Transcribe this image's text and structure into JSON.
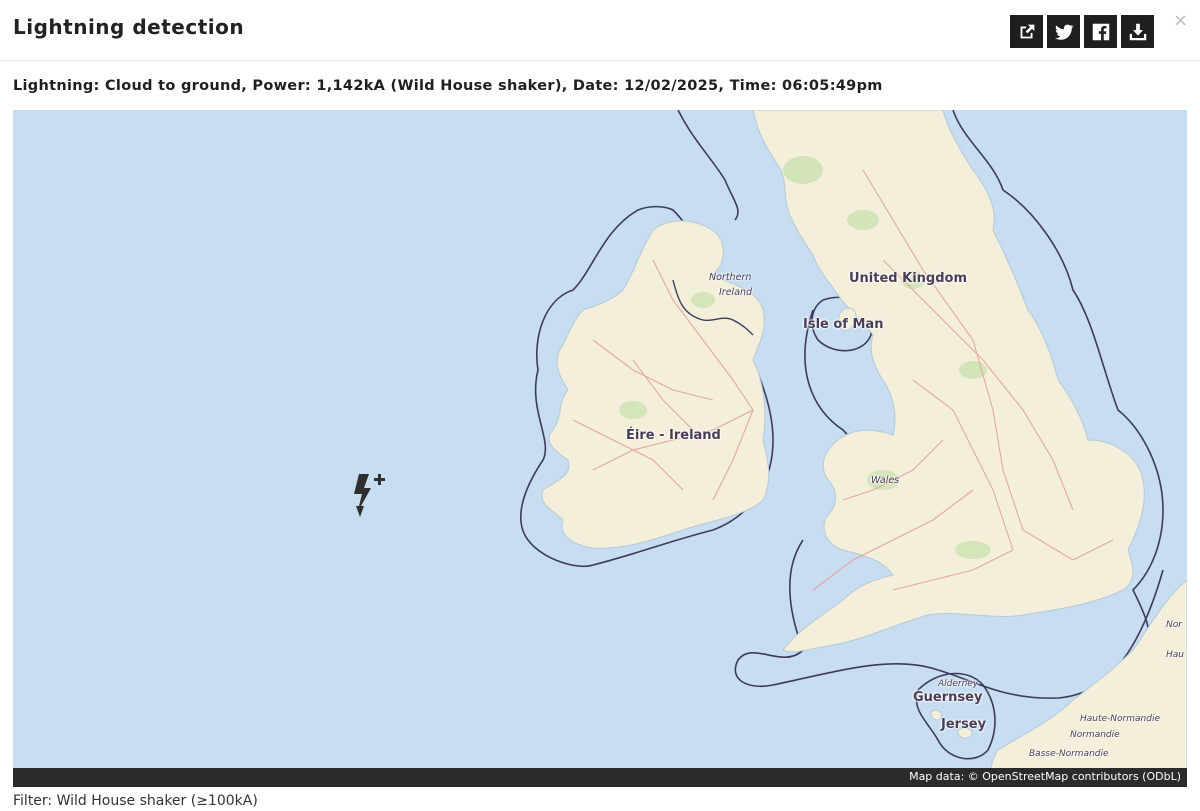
{
  "modal": {
    "title": "Lightning detection",
    "close_glyph": "×",
    "info": "Lightning: Cloud to ground, Power: 1,142kA (Wild House shaker), Date: 12/02/2025, Time: 06:05:49pm",
    "filter": "Filter: Wild House shaker (≥100kA)"
  },
  "toolbar": {
    "buttons": [
      {
        "name": "share-button",
        "icon": "external-share-icon"
      },
      {
        "name": "twitter-button",
        "icon": "twitter-icon"
      },
      {
        "name": "facebook-button",
        "icon": "facebook-icon"
      },
      {
        "name": "download-button",
        "icon": "download-icon"
      }
    ]
  },
  "map": {
    "labels": {
      "united_kingdom": "United Kingdom",
      "northern_ireland_1": "Northern",
      "northern_ireland_2": "Ireland",
      "isle_of_man": "Isle of Man",
      "eire": "Éire - Ireland",
      "wales": "Wales",
      "alderney": "Alderney",
      "guernsey": "Guernsey",
      "jersey": "Jersey",
      "haute_normandie": "Haute-Normandie",
      "normandie": "Normandie",
      "basse_normandie": "Basse-Normandie",
      "nord_partial": "Nor",
      "haut_partial": "Hau"
    },
    "attribution": "Map data: © OpenStreetMap contributors (ODbL)",
    "marker": {
      "type": "cloud-to-ground",
      "polarity": "+",
      "icon": "lightning-bolt-icon"
    },
    "colors": {
      "sea": "#c6ddf2",
      "land": "#f3efda",
      "border": "#3d3b5c",
      "roads": "#e6a09a"
    }
  }
}
